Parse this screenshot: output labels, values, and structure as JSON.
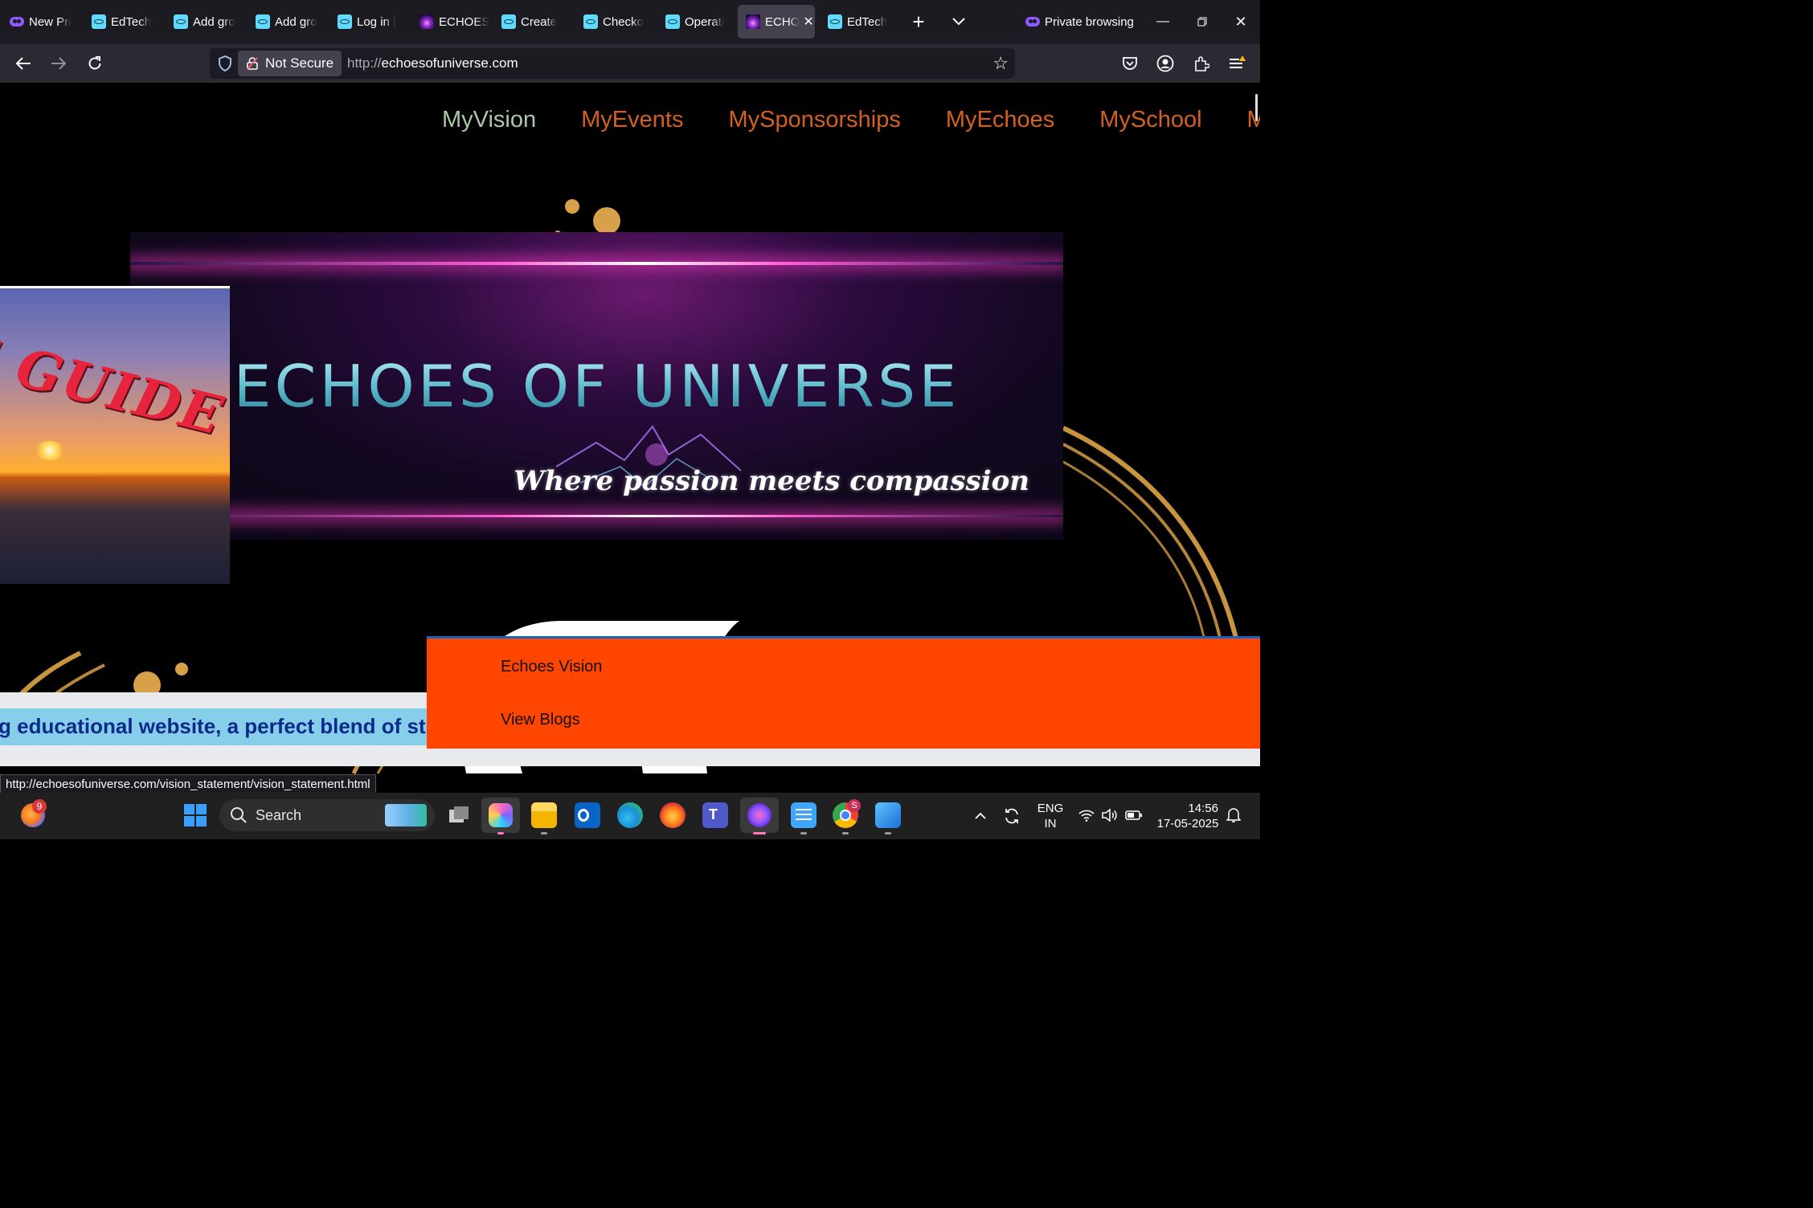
{
  "browser": {
    "tabs": [
      {
        "label": "New Pri",
        "favicon": "private-browsing-icon",
        "active": false
      },
      {
        "label": "EdTech",
        "favicon": "react-icon",
        "active": false
      },
      {
        "label": "Add gro",
        "favicon": "react-icon",
        "active": false
      },
      {
        "label": "Add gro",
        "favicon": "react-icon",
        "active": false
      },
      {
        "label": "Log in |",
        "favicon": "react-icon",
        "active": false
      },
      {
        "label": "ECHOES",
        "favicon": "echoes-icon",
        "active": false
      },
      {
        "label": "Create",
        "favicon": "react-icon",
        "active": false
      },
      {
        "label": "Checko",
        "favicon": "react-icon",
        "active": false
      },
      {
        "label": "Operati",
        "favicon": "react-icon",
        "active": false
      },
      {
        "label": "ECHO",
        "favicon": "echoes-icon",
        "active": true
      },
      {
        "label": "EdTech",
        "favicon": "react-icon",
        "active": false
      }
    ],
    "private_label": "Private browsing",
    "not_secure_label": "Not Secure",
    "url_protocol": "http://",
    "url_host": "echoesofuniverse.com"
  },
  "site": {
    "nav": [
      {
        "label": "MyVision",
        "color": "#a8c8a8"
      },
      {
        "label": "MyEvents",
        "color": "#d2611f"
      },
      {
        "label": "MySponsorships",
        "color": "#d2611f"
      },
      {
        "label": "MyEchoes",
        "color": "#d2611f"
      },
      {
        "label": "MySchool",
        "color": "#d2611f"
      },
      {
        "label": "MyS",
        "color": "#d2611f"
      }
    ],
    "banner_title": "ECHOES OF UNIVERSE",
    "banner_tagline": "Where passion meets compassion",
    "guide_text": "E GUIDE",
    "marquee_text": "g educational website, a perfect blend of study",
    "dropdown": [
      "Echoes Vision",
      "View Blogs"
    ],
    "status_url": "http://echoesofuniverse.com/vision_statement/vision_statement.html"
  },
  "taskbar": {
    "weather_badge": "9",
    "search_label": "Search",
    "lang_line1": "ENG",
    "lang_line2": "IN",
    "time": "14:56",
    "date": "17-05-2025",
    "chrome_badge": "S"
  },
  "colors": {
    "dropdown_bg": "#ff4500",
    "marquee_bg": "#87ceeb",
    "nav_active": "#a8c8a8",
    "nav_default": "#d2611f"
  }
}
